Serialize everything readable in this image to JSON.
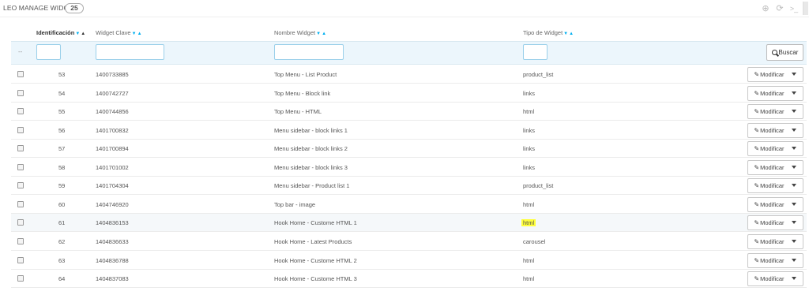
{
  "header": {
    "title": "LEO MANAGE WIDGETS",
    "count": "25"
  },
  "columns": {
    "id": "Identificación",
    "key": "Widget Clave",
    "name": "Nombre Widget",
    "type": "Tipo de Widget"
  },
  "filter": {
    "dash": "--",
    "search_label": "Buscar"
  },
  "actions": {
    "edit_label": "Modificar"
  },
  "rows": [
    {
      "id": "53",
      "key": "1400733885",
      "name": "Top Menu - List Product",
      "type": "product_list"
    },
    {
      "id": "54",
      "key": "1400742727",
      "name": "Top Menu - Block link",
      "type": "links"
    },
    {
      "id": "55",
      "key": "1400744856",
      "name": "Top Menu - HTML",
      "type": "html"
    },
    {
      "id": "56",
      "key": "1401700832",
      "name": "Menu sidebar - block links 1",
      "type": "links"
    },
    {
      "id": "57",
      "key": "1401700894",
      "name": "Menu sidebar - block links 2",
      "type": "links"
    },
    {
      "id": "58",
      "key": "1401701002",
      "name": "Menu sidebar - block links 3",
      "type": "links"
    },
    {
      "id": "59",
      "key": "1401704304",
      "name": "Menu sidebar - Product list 1",
      "type": "product_list"
    },
    {
      "id": "60",
      "key": "1404746920",
      "name": "Top bar - image",
      "type": "html"
    },
    {
      "id": "61",
      "key": "1404836153",
      "name": "Hook Home - Custome HTML 1",
      "type": "html"
    },
    {
      "id": "62",
      "key": "1404836633",
      "name": "Hook Home - Latest Products",
      "type": "carousel"
    },
    {
      "id": "63",
      "key": "1404836788",
      "name": "Hook Home - Custome HTML 2",
      "type": "html"
    },
    {
      "id": "64",
      "key": "1404837083",
      "name": "Hook Home - Custome HTML 3",
      "type": "html"
    }
  ],
  "highlight_color": "#ffff3a",
  "accent_color": "#00aff0"
}
